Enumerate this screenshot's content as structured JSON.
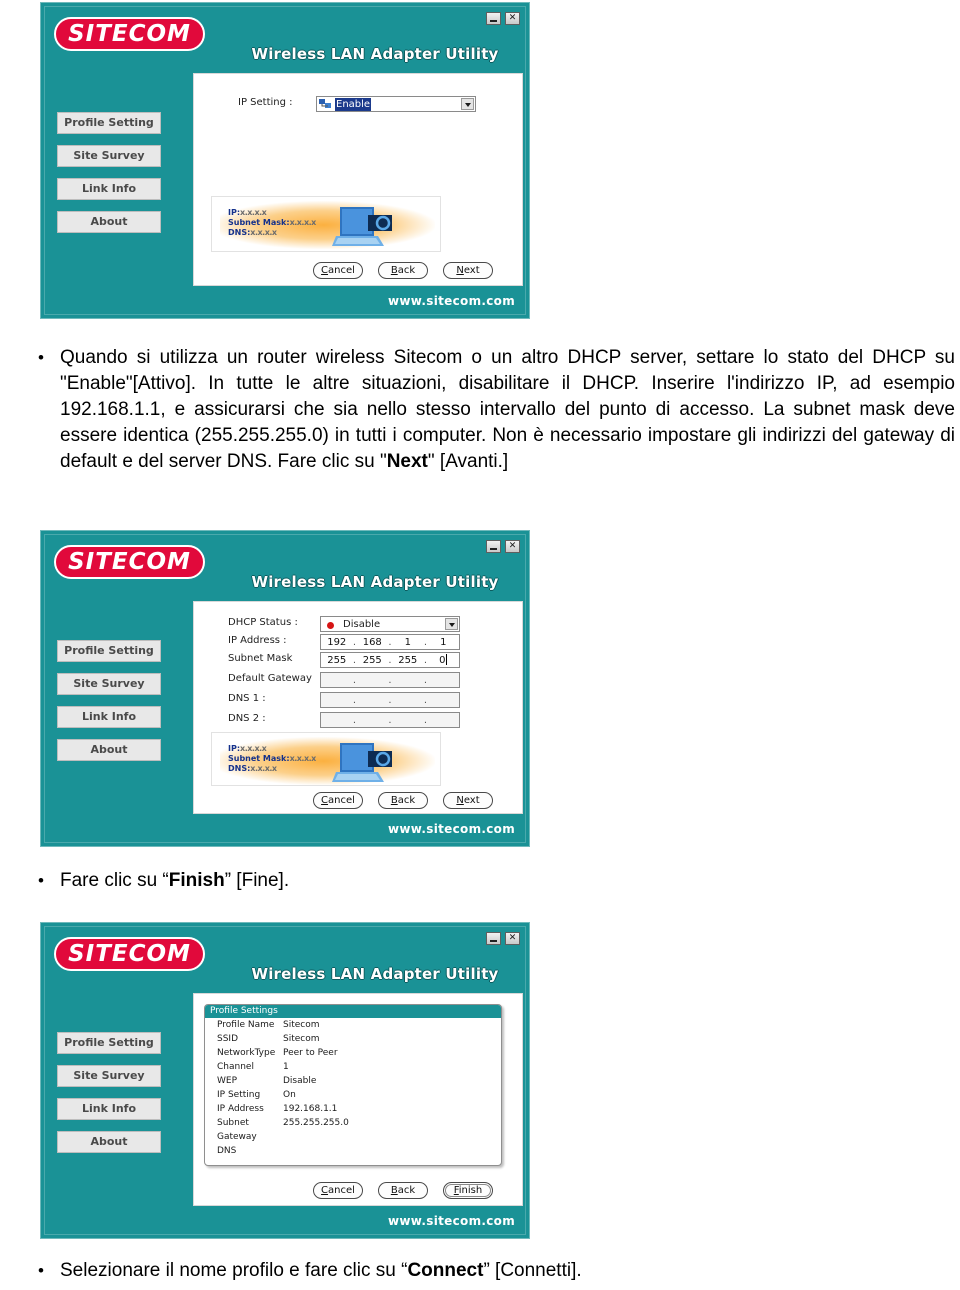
{
  "app": {
    "brand": "SITECOM",
    "title": "Wireless LAN Adapter Utility",
    "footer_url": "www.sitecom.com",
    "teal": "#1a9296",
    "brand_red": "#e1093b",
    "sidebar": [
      {
        "label": "Profile Setting"
      },
      {
        "label": "Site Survey"
      },
      {
        "label": "Link Info"
      },
      {
        "label": "About"
      }
    ],
    "window_controls": {
      "minimize": "minimize-icon",
      "close": "✕"
    },
    "illustration": {
      "ip_line": "IP:",
      "ip_value": "x.x.x.x",
      "subnet_line": "Subnet Mask:",
      "subnet_value": "x.x.x.x",
      "dns_line": "DNS:",
      "dns_value": "x.x.x.x"
    }
  },
  "screen1": {
    "ip_setting_label": "IP Setting :",
    "ip_setting_value": "Enable",
    "ip_setting_icon": "network-adapter-icon",
    "buttons": {
      "cancel_accel": "C",
      "cancel_rest": "ancel",
      "back_accel": "B",
      "back_rest": "ack",
      "next_accel": "N",
      "next_rest": "ext"
    }
  },
  "screen2": {
    "rows": [
      {
        "label": "DHCP Status :",
        "type": "combo",
        "value": "Disable",
        "icon": "red-dot-icon"
      },
      {
        "label": "IP Address :",
        "type": "ip",
        "segments": [
          "192",
          "168",
          "1",
          "1"
        ],
        "enabled": true
      },
      {
        "label": "Subnet Mask",
        "type": "ip",
        "segments": [
          "255",
          "255",
          "255",
          "0"
        ],
        "enabled": true,
        "caret": true
      },
      {
        "label": "Default Gateway",
        "type": "ip",
        "segments": [
          "",
          "",
          "",
          ""
        ],
        "enabled": false
      },
      {
        "label": "DNS 1 :",
        "type": "ip",
        "segments": [
          "",
          "",
          "",
          ""
        ],
        "enabled": false
      },
      {
        "label": "DNS 2 :",
        "type": "ip",
        "segments": [
          "",
          "",
          "",
          ""
        ],
        "enabled": false
      }
    ],
    "buttons": {
      "cancel_accel": "C",
      "cancel_rest": "ancel",
      "back_accel": "B",
      "back_rest": "ack",
      "next_accel": "N",
      "next_rest": "ext"
    }
  },
  "screen3": {
    "panel_title": "Profile Settings",
    "rows": [
      {
        "key": "Profile Name",
        "value": "Sitecom"
      },
      {
        "key": "SSID",
        "value": "Sitecom"
      },
      {
        "key": "NetworkType",
        "value": "Peer to Peer"
      },
      {
        "key": "Channel",
        "value": "1"
      },
      {
        "key": "WEP",
        "value": "Disable"
      },
      {
        "key": "IP Setting",
        "value": "On"
      },
      {
        "key": "IP Address",
        "value": "192.168.1.1"
      },
      {
        "key": "Subnet",
        "value": "255.255.255.0"
      },
      {
        "key": "Gateway",
        "value": ""
      },
      {
        "key": "DNS",
        "value": ""
      }
    ],
    "buttons": {
      "cancel_accel": "C",
      "cancel_rest": "ancel",
      "back_accel": "B",
      "back_rest": "ack",
      "finish_accel": "F",
      "finish_rest": "inish"
    }
  },
  "doc": {
    "bullet_glyph": "•",
    "para1_a": "Quando si utilizza un router wireless Sitecom o un altro DHCP server, settare lo stato del DHCP su \"Enable\"[Attivo]. In tutte le altre situazioni, disabilitare il DHCP. Inserire l'indirizzo IP, ad esempio 192.168.1.1, e assicurarsi che sia nello stesso intervallo del punto di accesso. La subnet mask deve essere identica (255.255.255.0) in tutti i computer. Non è necessario impostare gli indirizzi del gateway di default e del server DNS. Fare clic su \"",
    "para1_b": "Next",
    "para1_c": "\" [Avanti.]",
    "para2_a": "Fare clic su “",
    "para2_b": "Finish",
    "para2_c": "” [Fine].",
    "para3_a": "Selezionare il nome profilo e fare clic su “",
    "para3_b": "Connect",
    "para3_c": "” [Connetti]."
  }
}
